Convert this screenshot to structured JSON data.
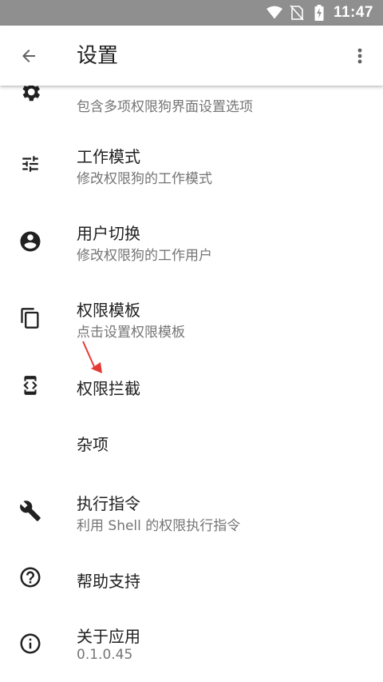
{
  "status_bar": {
    "time": "11:47",
    "icons": [
      "wifi-icon",
      "no-sim-icon",
      "battery-charging-icon"
    ]
  },
  "app_bar": {
    "title": "设置",
    "back_icon": "arrow-back-icon",
    "more_icon": "more-vert-icon"
  },
  "items": [
    {
      "icon": "settings-gear-icon",
      "title": "",
      "subtitle": "包含多项权限狗界面设置选项"
    },
    {
      "icon": "tune-icon",
      "title": "工作模式",
      "subtitle": "修改权限狗的工作模式"
    },
    {
      "icon": "account-circle-icon",
      "title": "用户切换",
      "subtitle": "修改权限狗的工作用户"
    },
    {
      "icon": "copy-icon",
      "title": "权限模板",
      "subtitle": "点击设置权限模板"
    },
    {
      "icon": "developer-mode-icon",
      "title": "权限拦截",
      "subtitle": ""
    },
    {
      "icon": "",
      "title": "杂项",
      "subtitle": ""
    },
    {
      "icon": "wrench-icon",
      "title": "执行指令",
      "subtitle": "利用 Shell 的权限执行指令"
    },
    {
      "icon": "help-icon",
      "title": "帮助支持",
      "subtitle": ""
    },
    {
      "icon": "info-icon",
      "title": "关于应用",
      "subtitle": "0.1.0.45"
    }
  ],
  "colors": {
    "status_bar": "#8f8f8f",
    "icon": "#212121",
    "subtitle": "#757575",
    "annotation_arrow": "#e53935"
  }
}
